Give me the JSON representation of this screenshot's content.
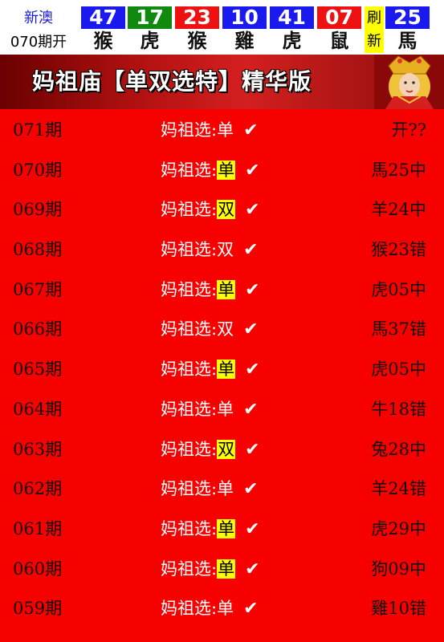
{
  "header": {
    "brand": "新澳",
    "period_open": "070期开",
    "balls": [
      {
        "number": "47",
        "zodiac": "猴",
        "color": "#1a1aef"
      },
      {
        "number": "17",
        "zodiac": "虎",
        "color": "#0f8a0f"
      },
      {
        "number": "23",
        "zodiac": "猴",
        "color": "#ee1111"
      },
      {
        "number": "10",
        "zodiac": "雞",
        "color": "#1a1aef"
      },
      {
        "number": "41",
        "zodiac": "虎",
        "color": "#1a1aef"
      },
      {
        "number": "07",
        "zodiac": "鼠",
        "color": "#ee1111"
      },
      {
        "number": "25",
        "zodiac": "馬",
        "color": "#1a1aef"
      }
    ],
    "refresh": [
      "刷",
      "新"
    ]
  },
  "banner": {
    "title": "妈祖庙【单双选特】精华版"
  },
  "rows": [
    {
      "period": "071期",
      "label": "妈祖选:",
      "pick": "单",
      "check": "✔",
      "highlight": false,
      "result": "开??"
    },
    {
      "period": "070期",
      "label": "妈祖选:",
      "pick": "单",
      "check": "✔",
      "highlight": true,
      "result": "馬25中"
    },
    {
      "period": "069期",
      "label": "妈祖选:",
      "pick": "双",
      "check": "✔",
      "highlight": true,
      "result": "羊24中"
    },
    {
      "period": "068期",
      "label": "妈祖选:",
      "pick": "双",
      "check": "✔",
      "highlight": false,
      "result": "猴23错"
    },
    {
      "period": "067期",
      "label": "妈祖选:",
      "pick": "单",
      "check": "✔",
      "highlight": true,
      "result": "虎05中"
    },
    {
      "period": "066期",
      "label": "妈祖选:",
      "pick": "双",
      "check": "✔",
      "highlight": false,
      "result": "馬37错"
    },
    {
      "period": "065期",
      "label": "妈祖选:",
      "pick": "单",
      "check": "✔",
      "highlight": true,
      "result": "虎05中"
    },
    {
      "period": "064期",
      "label": "妈祖选:",
      "pick": "单",
      "check": "✔",
      "highlight": false,
      "result": "牛18错"
    },
    {
      "period": "063期",
      "label": "妈祖选:",
      "pick": "双",
      "check": "✔",
      "highlight": true,
      "result": "兔28中"
    },
    {
      "period": "062期",
      "label": "妈祖选:",
      "pick": "单",
      "check": "✔",
      "highlight": false,
      "result": "羊24错"
    },
    {
      "period": "061期",
      "label": "妈祖选:",
      "pick": "单",
      "check": "✔",
      "highlight": true,
      "result": "虎29中"
    },
    {
      "period": "060期",
      "label": "妈祖选:",
      "pick": "单",
      "check": "✔",
      "highlight": true,
      "result": "狗09中"
    },
    {
      "period": "059期",
      "label": "妈祖选:",
      "pick": "单",
      "check": "✔",
      "highlight": false,
      "result": "雞10错"
    }
  ]
}
